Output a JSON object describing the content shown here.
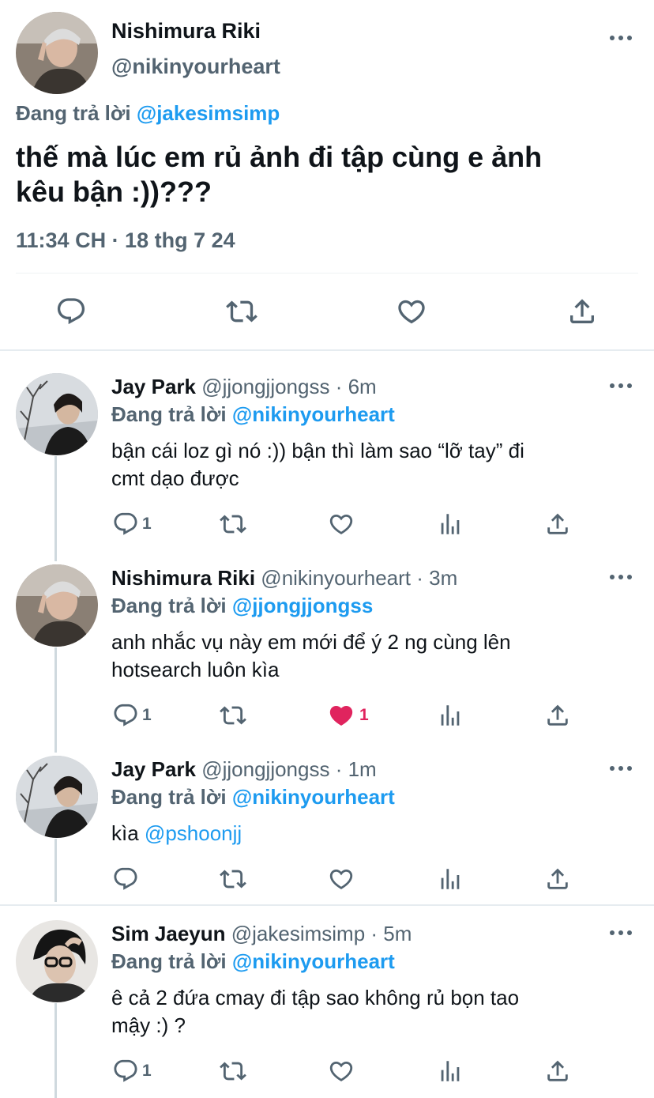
{
  "main_tweet": {
    "display_name": "Nishimura Riki",
    "handle": "@nikinyourheart",
    "reply_prefix": "Đang trả lời",
    "reply_to": "@jakesimsimp",
    "text_line1": "thế mà lúc em rủ ảnh đi tập cùng e ảnh",
    "text_line2": "kêu bận :))???",
    "timestamp": "11:34 CH · 18 thg 7 24"
  },
  "replies": [
    {
      "display_name": "Jay Park",
      "meta": "@jjongjjongss · 6m",
      "reply_prefix": "Đang trả lời",
      "reply_to": "@nikinyourheart",
      "text_line1": "bận cái loz gì nó :)) bận thì làm sao “lỡ tay” đi",
      "text_line2": "cmt dạo được",
      "reply_count": "1",
      "like_count": ""
    },
    {
      "display_name": "Nishimura Riki",
      "meta": "@nikinyourheart · 3m",
      "reply_prefix": "Đang trả lời",
      "reply_to": "@jjongjjongss",
      "text_line1": "anh nhắc vụ này em mới để ý 2 ng cùng lên",
      "text_line2": "hotsearch luôn kìa",
      "reply_count": "1",
      "like_count": "1",
      "liked": true
    },
    {
      "display_name": "Jay Park",
      "meta": "@jjongjjongss · 1m",
      "reply_prefix": "Đang trả lời",
      "reply_to": "@nikinyourheart",
      "text_prefix": "kìa ",
      "mention": "@pshoonjj",
      "reply_count": "",
      "like_count": ""
    },
    {
      "display_name": "Sim Jaeyun",
      "meta": "@jakesimsimp · 5m",
      "reply_prefix": "Đang trả lời",
      "reply_to": "@nikinyourheart",
      "text_line1": "ê cả 2 đứa cmay đi tập sao không rủ bọn tao",
      "text_line2": "mậy :) ?",
      "reply_count": "1",
      "like_count": ""
    }
  ],
  "colors": {
    "text": "#0f1419",
    "secondary": "#536471",
    "link": "#1d9bf0",
    "like": "#f91880",
    "divider": "#eff3f4"
  },
  "icons": [
    "more-icon",
    "reply-icon",
    "retweet-icon",
    "like-icon",
    "share-icon",
    "analytics-icon"
  ]
}
